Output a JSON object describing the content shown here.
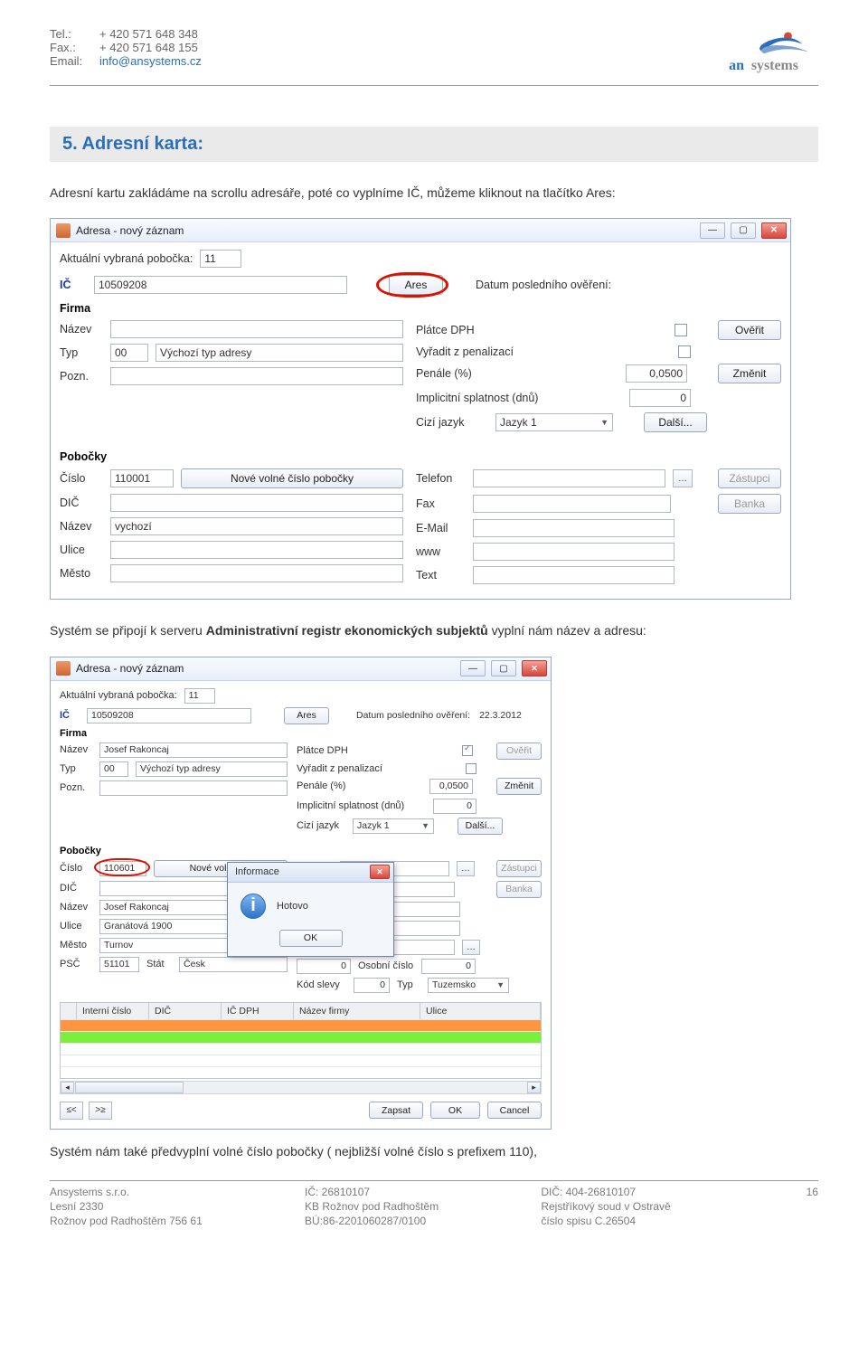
{
  "header": {
    "tel_label": "Tel.:",
    "tel_value": "+ 420 571 648 348",
    "fax_label": "Fax.:",
    "fax_value": "+ 420 571 648 155",
    "email_label": "Email:",
    "email_value": "info@ansystems.cz",
    "logo_text_1": "an",
    "logo_text_2": "systems"
  },
  "section": {
    "title": "5. Adresní karta:",
    "p1": "Adresní kartu zakládáme na scrollu adresáře, poté co vyplníme IČ, můžeme kliknout na tlačítko Ares:",
    "p2_prefix": "Systém se připojí k serveru ",
    "p2_bold": "Administrativní registr ekonomických subjektů",
    "p2_suffix": " vyplní nám název a adresu:",
    "p3": "Systém nám také předvyplní volné číslo pobočky ( nejbližší volné číslo s prefixem 110),"
  },
  "win1": {
    "title": "Adresa - nový záznam",
    "pobocka_label": "Aktuální vybraná pobočka:",
    "pobocka_value": "11",
    "ic_label": "IČ",
    "ic_value": "10509208",
    "ares_btn": "Ares",
    "date_label": "Datum posledního ověření:",
    "firma": "Firma",
    "nazev_label": "Název",
    "typ_label": "Typ",
    "typ_code": "00",
    "typ_desc": "Výchozí typ adresy",
    "pozn_label": "Pozn.",
    "platce_dph": "Plátce DPH",
    "overit_btn": "Ověřit",
    "vyradit": "Vyřadit z penalizací",
    "penale_label": "Penále (%)",
    "penale_value": "0,0500",
    "zmenit_btn": "Změnit",
    "splatnost_label": "Implicitní splatnost (dnů)",
    "splatnost_value": "0",
    "jazyk_label": "Cizí jazyk",
    "jazyk_value": "Jazyk 1",
    "dalsi_btn": "Další...",
    "pobocky": "Pobočky",
    "cislo_label": "Číslo",
    "cislo_value": "110001",
    "nove_cislo_btn": "Nové volné číslo pobočky",
    "telefon_label": "Telefon",
    "zastupci_btn": "Zástupci",
    "dic_label": "DIČ",
    "fax_label": "Fax",
    "banka_btn": "Banka",
    "nazev2_label": "Název",
    "nazev2_value": "vychozí",
    "email2_label": "E-Mail",
    "ulice_label": "Ulice",
    "www_label": "www",
    "mesto_label": "Město",
    "text_label": "Text"
  },
  "win2": {
    "title": "Adresa - nový záznam",
    "pobocka_value": "11",
    "ic_value": "10509208",
    "ares_btn": "Ares",
    "date_label": "Datum posledního ověření:",
    "date_value": "22.3.2012",
    "nazev_value": "Josef Rakoncaj",
    "typ_code": "00",
    "typ_desc": "Výchozí typ adresy",
    "penale_value": "0,0500",
    "splatnost_value": "0",
    "jazyk_value": "Jazyk 1",
    "cislo_value": "110601",
    "nove_cislo_btn": "Nové volné čís",
    "nazev2_value": "Josef Rakoncaj",
    "ulice_value": "Granátová 1900",
    "mesto_value": "Turnov",
    "psc_label": "PSČ",
    "psc_value": "51101",
    "stat_label": "Stát",
    "stat_value": "Česk",
    "zero": "0",
    "osobni_label": "Osobní číslo",
    "kod_slevy_label": "Kód slevy",
    "typ2_label": "Typ",
    "tuzemsko": "Tuzemsko",
    "grid_cols": [
      "Interní číslo",
      "DIČ",
      "IČ DPH",
      "Název firmy",
      "Ulice"
    ],
    "zapsat": "Zapsat",
    "ok": "OK",
    "cancel": "Cancel",
    "nav_prev": "≤<",
    "nav_next": ">≥"
  },
  "dialog": {
    "title": "Informace",
    "msg": "Hotovo",
    "ok": "OK"
  },
  "footer": {
    "c1_l1": "Ansystems s.r.o.",
    "c1_l2": "Lesní 2330",
    "c1_l3": "Rožnov pod Radhoštěm 756 61",
    "c2_l1": "IČ: 26810107",
    "c2_l2": "KB Rožnov pod Radhoštěm",
    "c2_l3": "BÚ:86-2201060287/0100",
    "c3_l1": "DIČ: 404-26810107",
    "c3_l2": "Rejstříkový soud v Ostravě",
    "c3_l3": "číslo spisu C.26504",
    "page": "16"
  }
}
